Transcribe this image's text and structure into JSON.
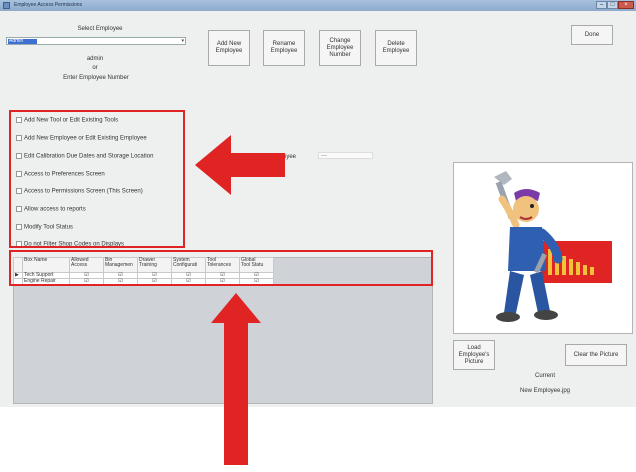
{
  "window": {
    "title": "Employee Access Permissions"
  },
  "employee": {
    "select_label": "Select Employee",
    "combo_value": "Admin",
    "name": "admin",
    "or_text": "or",
    "number_label": "Enter Employee Number"
  },
  "toolbar": {
    "add": "Add New\nEmployee",
    "rename": "Rename\nEmployee",
    "change": "Change\nEmployee\nNumber",
    "delete": "Delete\nEmployee",
    "done": "Done"
  },
  "permissions": [
    "Add New Tool or Edit Existing Tools",
    "Add New Employee or Edit Existing Employee",
    "Edit Calibration Due Dates and Storage Location",
    "Access to Preferences Screen",
    "Access to Permissions Screen (This Screen)",
    "Allow access to reports",
    "Modify Tool Status",
    "Do not Filter Shop Codes on Displays"
  ],
  "partial_label": "oyee",
  "grid": {
    "columns": [
      "Box Name",
      "Allowed\nAccess",
      "Bin\nManagemen",
      "Drawer\nTraining",
      "System\nConfigurati",
      "Tool\nTolerances",
      "Global\nTool Statu"
    ],
    "rows": [
      {
        "name": "Tech Support",
        "marker": "▶",
        "cells": [
          "☑",
          "☑",
          "☑",
          "☑",
          "☑",
          "☑"
        ]
      },
      {
        "name": "Engine Repair",
        "marker": "",
        "cells": [
          "☑",
          "☑",
          "☑",
          "☑",
          "☑",
          "☑"
        ]
      }
    ]
  },
  "picture": {
    "load_button": "Load\nEmployee's\nPicture",
    "clear_button": "Clear the Picture",
    "current_label": "Current",
    "filename": "New Employee.jpg"
  },
  "colors": {
    "annotation_red": "#e02424"
  },
  "icons": {
    "minimize": "minimize-icon",
    "maximize": "maximize-icon",
    "close": "close-icon"
  }
}
